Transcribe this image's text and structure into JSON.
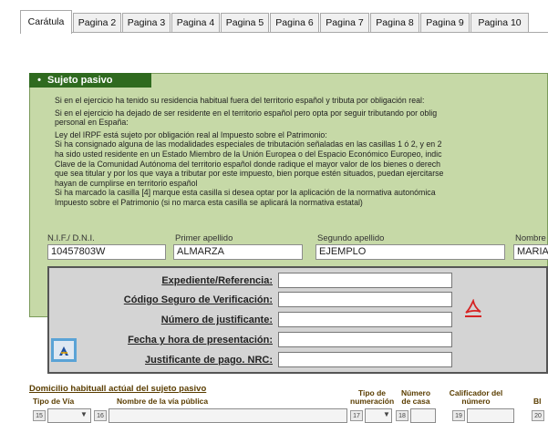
{
  "tabs": [
    "Carátula",
    "Pagina 2",
    "Pagina 3",
    "Pagina 4",
    "Pagina 5",
    "Pagina 6",
    "Pagina 7",
    "Pagina 8",
    "Pagina 9",
    "Pagina 10"
  ],
  "section": {
    "title": "Sujeto pasivo"
  },
  "notes": {
    "line1": "Si en el ejercicio ha tenido su residencia habitual fuera del territorio español y tributa por obligación real:",
    "line2a": "Si en el ejercicio ha dejado de ser residente en el territorio español pero opta por seguir tributando por oblig",
    "line2b": "personal en España:",
    "line3": "Ley del IRPF está sujeto por obligación real al Impuesto sobre el Patrimonio:",
    "line4": "Si ha consignado alguna de las modalidades especiales de tributación señaladas en las casillas 1 ó 2, y en 2",
    "line5": "ha sido usted residente en un Estado Miembro de la Unión Europea o del Espacio Económico Europeo, indic",
    "line6": "Clave de la Comunidad Autónoma del territorio español donde radique el mayor valor de los bienes o derech",
    "line7": "que sea titular y por los que vaya a tributar por este impuesto, bien porque estén situados, puedan ejercitarse",
    "line8": "hayan de cumplirse en territorio español",
    "line9": "Si ha marcado la casilla [4] marque esta casilla si desea optar por la aplicación de la normativa autonómica",
    "line10": "Impuesto sobre el Patrimonio (si no marca esta casilla se aplicará la normativa estatal)"
  },
  "taxpayer": {
    "nif_label": "N.I.F./ D.N.I.",
    "nif_value": "10457803W",
    "surname1_label": "Primer apellido",
    "surname1_value": "ALMARZA",
    "surname2_label": "Segundo apellido",
    "surname2_value": "EJEMPLO",
    "name_label": "Nombre",
    "name_value": "MARIA"
  },
  "docbox": {
    "expediente_label": "Expediente/Referencia:",
    "csv_label": "Código Seguro de Verificación:",
    "justificante_label": "Número de justificante:",
    "fecha_label": "Fecha y hora de presentación:",
    "nrc_label": "Justificante de pago. NRC:",
    "expediente_value": "",
    "csv_value": "",
    "justificante_value": "",
    "fecha_value": "",
    "nrc_value": ""
  },
  "domicilio": {
    "title": "Domicilio habituall actúal del sujeto pasivo",
    "col_tipo_via": "Tipo de Vía",
    "col_nombre_via": "Nombre de la vía pública",
    "col_tipo_num_a": "Tipo de",
    "col_tipo_num_b": "numeración",
    "col_numero_a": "Número",
    "col_numero_b": "de casa",
    "col_calif_a": "Calificador del",
    "col_calif_b": "número",
    "col_bl": "Bl",
    "badge_15": "15",
    "badge_16": "16",
    "badge_17": "17",
    "badge_18": "18",
    "badge_19": "19",
    "badge_20": "20"
  },
  "colors": {
    "panel_bg": "#c6d9a7",
    "panel_header": "#2f6a1f",
    "docbox_bg": "#d4d4d4",
    "section_title": "#5a3d00",
    "sign_button_border": "#5aa3d6"
  }
}
